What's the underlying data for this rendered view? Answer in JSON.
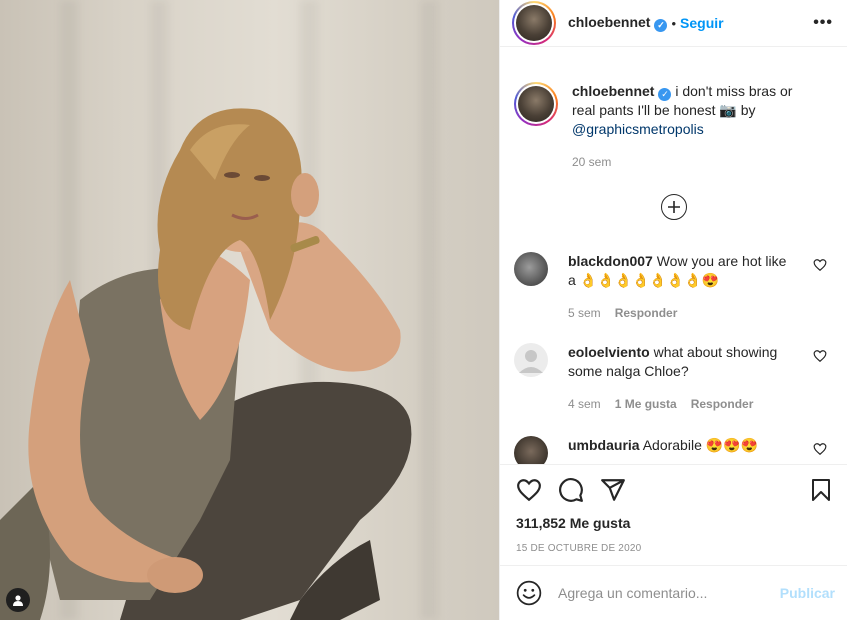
{
  "post": {
    "username": "chloebennet",
    "follow_label": "Seguir",
    "dot": "•",
    "more_label": "•••"
  },
  "caption": {
    "username": "chloebennet",
    "text": "i don't miss bras or real pants I'll be honest 📷 by",
    "mention": "@graphicsmetropolis",
    "time": "20 sem"
  },
  "comments": [
    {
      "username": "blackdon007",
      "text": "Wow you are hot like a 👌👌👌👌👌👌👌😍",
      "time": "5 sem",
      "likes": "",
      "reply": "Responder"
    },
    {
      "username": "eoloelviento",
      "text": "what about showing some nalga Chloe?",
      "time": "4 sem",
      "likes": "1 Me gusta",
      "reply": "Responder"
    },
    {
      "username": "umbdauria",
      "text": "Adorabile 😍😍😍",
      "time": "",
      "likes": "",
      "reply": ""
    }
  ],
  "actions": {
    "likes_count": "311,852 Me gusta",
    "date": "15 de octubre de 2020"
  },
  "add_comment": {
    "placeholder": "Agrega un comentario...",
    "publish_label": "Publicar"
  },
  "colors": {
    "accent": "#0095f6",
    "verified": "#3897f0",
    "muted": "#8e8e8e"
  }
}
